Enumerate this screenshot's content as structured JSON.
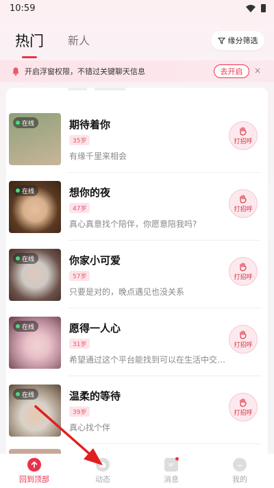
{
  "status": {
    "time": "10:59"
  },
  "tabs": [
    {
      "label": "热门",
      "active": true
    },
    {
      "label": "新人",
      "active": false
    }
  ],
  "filter_label": "缘分筛选",
  "notice": {
    "text": "开启浮窗权限，不错过关键聊天信息",
    "button": "去开启",
    "close": "×"
  },
  "online_label": "在线",
  "greet_label": "打招呼",
  "users": [
    {
      "name": "期待着你",
      "age": "35岁",
      "bio": "有缘千里来相会",
      "avatar_colors": [
        "#8ea07a",
        "#c9b59a"
      ]
    },
    {
      "name": "想你的夜",
      "age": "47岁",
      "bio": "真心真意找个陪伴，你愿意陪我吗?",
      "avatar_colors": [
        "#7a5a3c",
        "#d8b08c"
      ]
    },
    {
      "name": "你家小可爱",
      "age": "57岁",
      "bio": "只要是对的，晚点遇见也没关系",
      "avatar_colors": [
        "#cfc9c4",
        "#8a7066"
      ]
    },
    {
      "name": "愿得一人心",
      "age": "31岁",
      "bio": "希望通过这个平台能找到可以在生活中交…",
      "avatar_colors": [
        "#b98c9a",
        "#e8c0c8"
      ]
    },
    {
      "name": "温柔的等待",
      "age": "39岁",
      "bio": "真心找个伴",
      "avatar_colors": [
        "#d9d2c8",
        "#9c8a78"
      ]
    }
  ],
  "nav": [
    {
      "label": "回到顶部",
      "active": true
    },
    {
      "label": "动态",
      "active": false
    },
    {
      "label": "消息",
      "active": false
    },
    {
      "label": "我的",
      "active": false
    }
  ],
  "colors": {
    "accent": "#e8334a",
    "online": "#3ee07a"
  }
}
